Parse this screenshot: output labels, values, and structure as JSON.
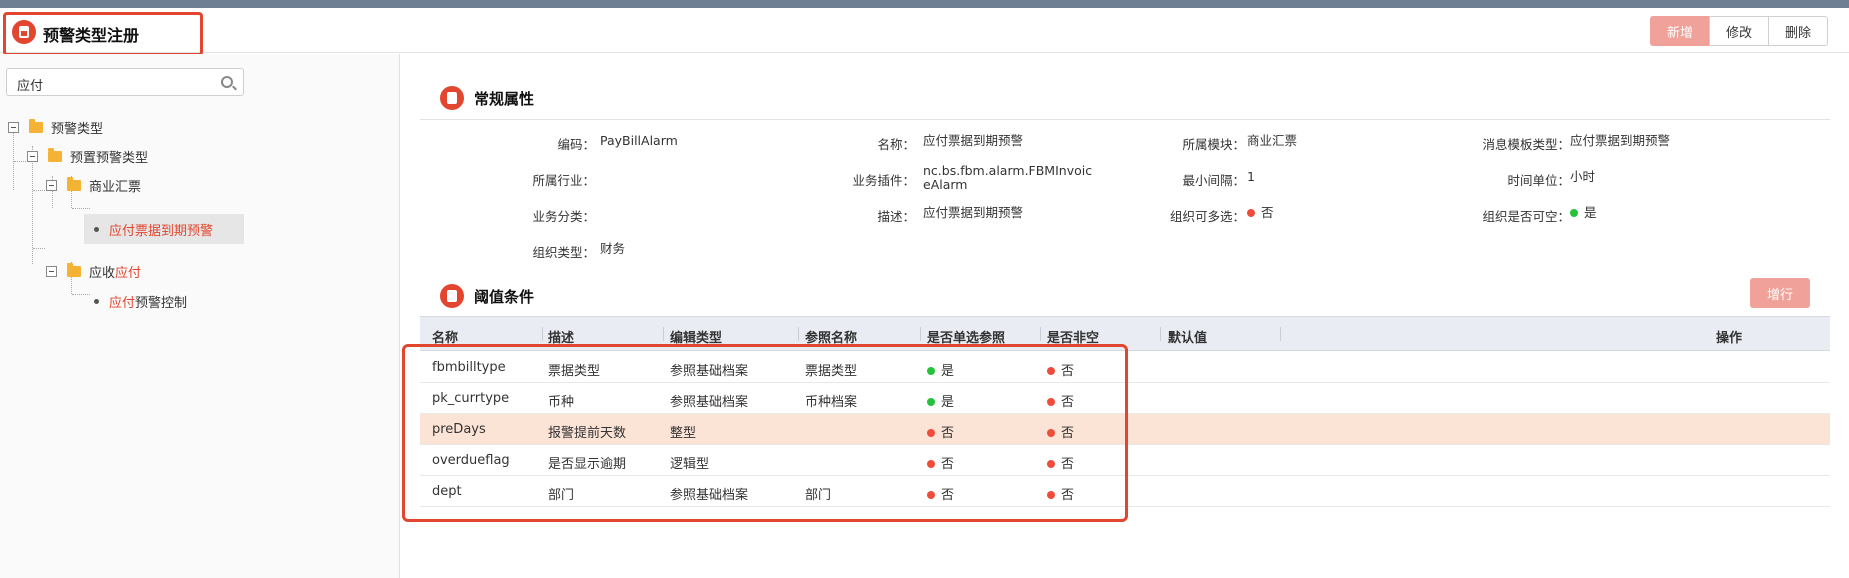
{
  "header": {
    "title": "预警类型注册",
    "buttons": {
      "add": "新增",
      "edit": "修改",
      "delete": "删除"
    }
  },
  "sidebar": {
    "search_value": "应付",
    "tree": {
      "root": "预警类型",
      "preset": "预置预警类型",
      "group1": "商业汇票",
      "leaf1": "应付票据到期预警",
      "group2_prefix": "应收",
      "group2_hl": "应付",
      "leaf2_hl": "应付",
      "leaf2_rest": "预警控制"
    }
  },
  "general": {
    "title": "常规属性",
    "code_label": "编码：",
    "code": "PayBillAlarm",
    "name_label": "名称：",
    "name": "应付票据到期预警",
    "module_label": "所属模块：",
    "module": "商业汇票",
    "msgtpl_label": "消息模板类型：",
    "msgtpl": "应付票据到期预警",
    "industry_label": "所属行业：",
    "industry": "",
    "plugin_label": "业务插件：",
    "plugin": "nc.bs.fbm.alarm.FBMInvoiceAlarm",
    "interval_label": "最小间隔：",
    "interval": "1",
    "unit_label": "时间单位：",
    "unit": "小时",
    "category_label": "业务分类：",
    "category": "",
    "desc_label": "描述：",
    "desc": "应付票据到期预警",
    "multi_org_label": "组织可多选：",
    "multi_org": "否",
    "org_empty_label": "组织是否可空：",
    "org_empty": "是",
    "orgtype_label": "组织类型：",
    "orgtype": "财务"
  },
  "threshold": {
    "title": "阈值条件",
    "add_row": "增行",
    "columns": [
      "名称",
      "描述",
      "编辑类型",
      "参照名称",
      "是否单选参照",
      "是否非空",
      "默认值",
      "操作"
    ],
    "rows": [
      {
        "name": "fbmbilltype",
        "desc": "票据类型",
        "edit": "参照基础档案",
        "ref": "票据类型",
        "single": "是",
        "single_color": "#27c23b",
        "required": "否",
        "default": ""
      },
      {
        "name": "pk_currtype",
        "desc": "币种",
        "edit": "参照基础档案",
        "ref": "币种档案",
        "single": "是",
        "single_color": "#27c23b",
        "required": "否",
        "default": ""
      },
      {
        "name": "preDays",
        "desc": "报警提前天数",
        "edit": "整型",
        "ref": "",
        "single": "否",
        "single_color": "#ef4d3c",
        "required": "否",
        "default": ""
      },
      {
        "name": "overdueflag",
        "desc": "是否显示逾期",
        "edit": "逻辑型",
        "ref": "",
        "single": "否",
        "single_color": "#ef4d3c",
        "required": "否",
        "default": ""
      },
      {
        "name": "dept",
        "desc": "部门",
        "edit": "参照基础档案",
        "ref": "部门",
        "single": "否",
        "single_color": "#ef4d3c",
        "required": "否",
        "default": ""
      }
    ]
  }
}
